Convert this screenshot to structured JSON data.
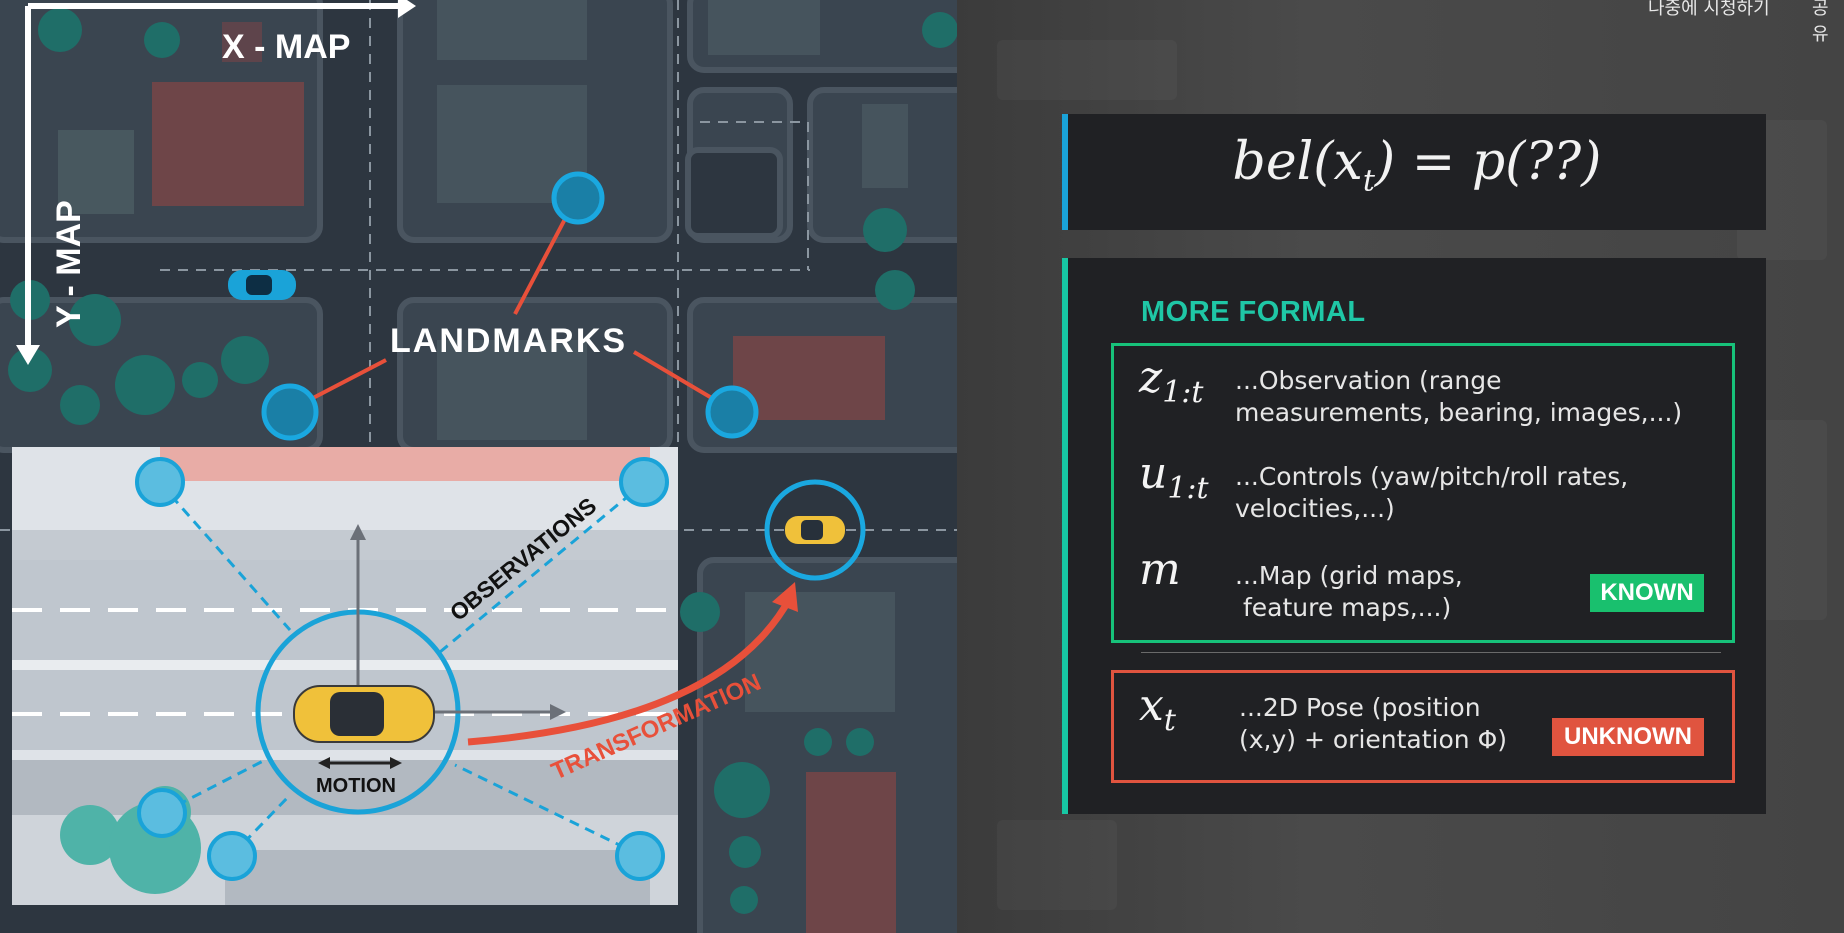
{
  "header": {
    "links": [
      "나중에 시청하기",
      "공유"
    ]
  },
  "map": {
    "x_axis_label": "X - MAP",
    "y_axis_label": "Y - MAP",
    "landmarks_label": "LANDMARKS",
    "observations_label": "OBSERVATIONS",
    "motion_label": "MOTION",
    "transformation_label": "TRANSFORMATION"
  },
  "equation": {
    "lhs": "bel(x",
    "lhs_sub": "t",
    "rhs": ") = p(??)"
  },
  "formal": {
    "title": "MORE FORMAL",
    "items": [
      {
        "symbol": "z",
        "sub": "1:t",
        "line1": "...Observation (range",
        "line2": "measurements, bearing, images,...)"
      },
      {
        "symbol": "u",
        "sub": "1:t",
        "line1": "...Controls (yaw/pitch/roll rates,",
        "line2": "velocities,...)"
      },
      {
        "symbol": "m",
        "sub": "",
        "line1": "...Map (grid maps,",
        "line2": " feature maps,...)"
      },
      {
        "symbol": "x",
        "sub": "t",
        "line1": "...2D Pose (position",
        "line2": "(x,y) + orientation Φ)"
      }
    ],
    "known_badge": "KNOWN",
    "unknown_badge": "UNKNOWN"
  },
  "colors": {
    "blue_accent": "#1aa3d8",
    "teal_accent": "#17c7a3",
    "known_green": "#19c06e",
    "unknown_red": "#e0543f",
    "transform_red": "#e8503a"
  }
}
